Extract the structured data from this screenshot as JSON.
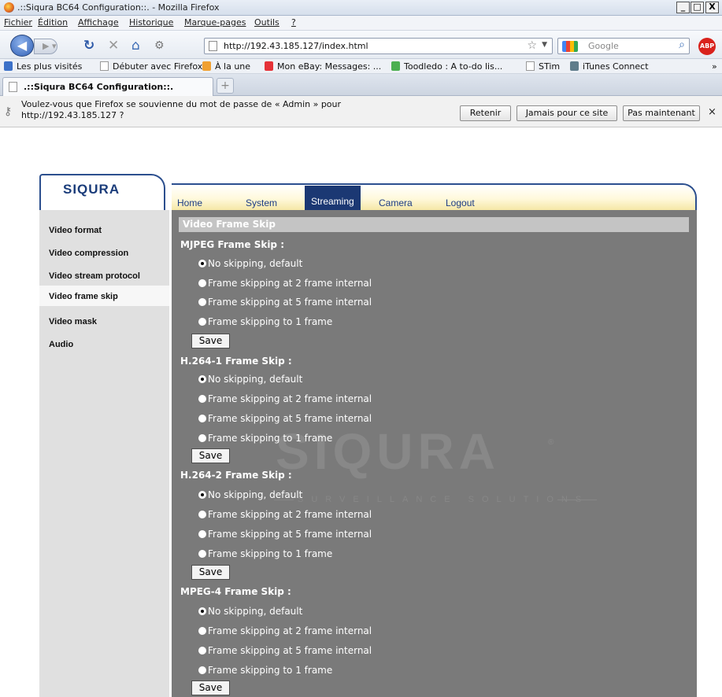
{
  "window": {
    "title": ".::Siqura BC64 Configuration::. - Mozilla Firefox",
    "min": "_",
    "max": "□",
    "close": "X"
  },
  "menu": [
    "Fichier",
    "Édition",
    "Affichage",
    "Historique",
    "Marque-pages",
    "Outils",
    "?"
  ],
  "nav": {
    "url": "http://192.43.185.127/index.html",
    "search_placeholder": "Google",
    "abp": "ABP"
  },
  "bookmarks": [
    {
      "label": "Les plus visités",
      "icon": "most-visited-icon",
      "color": "#3c71c8"
    },
    {
      "label": "Débuter avec Firefox",
      "icon": "page-icon",
      "color": "#ffffff"
    },
    {
      "label": "À la une",
      "icon": "rss-icon",
      "color": "#f0a030"
    },
    {
      "label": "Mon eBay: Messages: ...",
      "icon": "ebay-icon",
      "color": "#e53238"
    },
    {
      "label": "Toodledo : A to-do lis...",
      "icon": "check-icon",
      "color": "#4caf50"
    },
    {
      "label": "STim",
      "icon": "page-icon",
      "color": "#ffffff"
    },
    {
      "label": "iTunes Connect",
      "icon": "itunes-icon",
      "color": "#607d8b"
    }
  ],
  "bookmarks_more": "»",
  "tab": {
    "title": ".::Siqura BC64 Configuration::.",
    "new": "+"
  },
  "notification": {
    "message": "Voulez-vous que Firefox se souvienne du mot de passe de « Admin » pour http://192.43.185.127 ?",
    "remember": "Retenir",
    "never": "Jamais pour ce site",
    "not_now": "Pas maintenant",
    "close": "×"
  },
  "brand": {
    "logo": "SIQURA",
    "watermark": "SIQURA",
    "watermark_sub": "SURVEILLANCE SOLUTIONS",
    "trademark": "®"
  },
  "topnav": [
    "Home",
    "System",
    "Streaming",
    "Camera",
    "Logout"
  ],
  "topnav_active": "Streaming",
  "sidebar": [
    "Video format",
    "Video compression",
    "Video stream protocol",
    "Video frame skip",
    "Video mask",
    "Audio"
  ],
  "sidebar_active": "Video frame skip",
  "section_title": "Video Frame Skip",
  "groups": [
    {
      "title": "MJPEG Frame Skip :",
      "options": [
        "No skipping, default",
        "Frame skipping at 2 frame internal",
        "Frame skipping at 5 frame internal",
        "Frame skipping to 1 frame"
      ],
      "selected": 0
    },
    {
      "title": "H.264-1 Frame Skip :",
      "options": [
        "No skipping, default",
        "Frame skipping at 2 frame internal",
        "Frame skipping at 5 frame internal",
        "Frame skipping to 1 frame"
      ],
      "selected": 0
    },
    {
      "title": "H.264-2 Frame Skip :",
      "options": [
        "No skipping, default",
        "Frame skipping at 2 frame internal",
        "Frame skipping at 5 frame internal",
        "Frame skipping to 1 frame"
      ],
      "selected": 0
    },
    {
      "title": "MPEG-4 Frame Skip :",
      "options": [
        "No skipping, default",
        "Frame skipping at 2 frame internal",
        "Frame skipping at 5 frame internal",
        "Frame skipping to 1 frame"
      ],
      "selected": 0
    }
  ],
  "save_label": "Save",
  "colors": {
    "nav_active": "#1b3873",
    "panel": "#7a7a7a",
    "sidebar": "#e0e0e0",
    "nav_text": "#1d3d86"
  }
}
